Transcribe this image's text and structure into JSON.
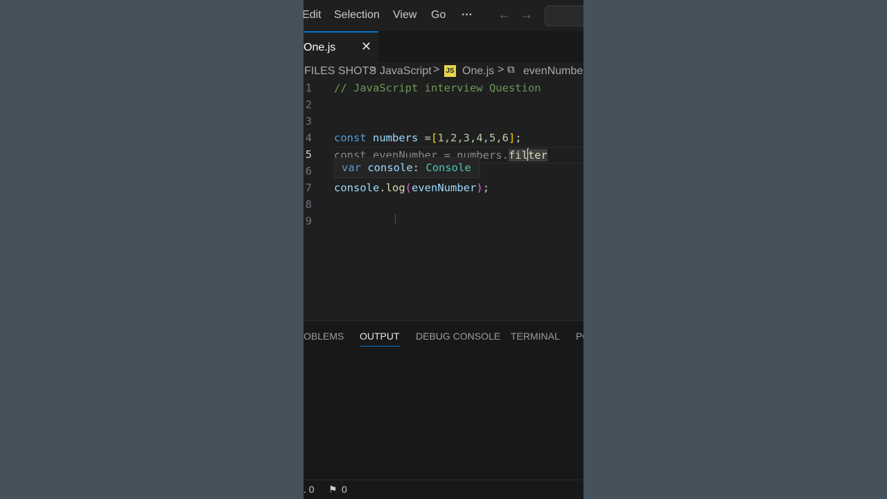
{
  "menubar": {
    "items": [
      "Edit",
      "Selection",
      "View",
      "Go",
      "···"
    ],
    "back_arrow": "←",
    "forward_arrow": "→"
  },
  "tab": {
    "label": "One.js",
    "close": "✕"
  },
  "breadcrumb": {
    "items": [
      "FILES SHOTS",
      "JavaScript",
      "One.js",
      "evenNumbe"
    ],
    "separator": ">",
    "file_icon": "JS",
    "symbol_icon": "⧉"
  },
  "editor": {
    "line_numbers": [
      "1",
      "2",
      "3",
      "4",
      "5",
      "6",
      "7",
      "8",
      "9"
    ],
    "active_line": "5",
    "line1_comment": "// JavaScript interview Question",
    "line4": {
      "kw": "const",
      "name": "numbers",
      "op": " =",
      "open": "[",
      "values": "1,2,3,4,5,6",
      "close": "]",
      "end": ";"
    },
    "line5": {
      "visible_left": "const evenNumber = numbers.",
      "word_before_caret": "fil",
      "word_after_caret": "ter"
    },
    "line7": {
      "obj": "console",
      "dot": ".",
      "method": "log",
      "open": "(",
      "arg": "evenNumber",
      "close": ")",
      "end": ";"
    }
  },
  "hover": {
    "kw": "var",
    "name": "console",
    "colon": ":",
    "type": "Console"
  },
  "panel": {
    "tabs": [
      "OBLEMS",
      "OUTPUT",
      "DEBUG CONSOLE",
      "TERMINAL",
      "PO"
    ],
    "active_tab": "OUTPUT"
  },
  "status": {
    "problems_count": ". 0",
    "ports_icon": "⚑",
    "ports_count": "0"
  }
}
